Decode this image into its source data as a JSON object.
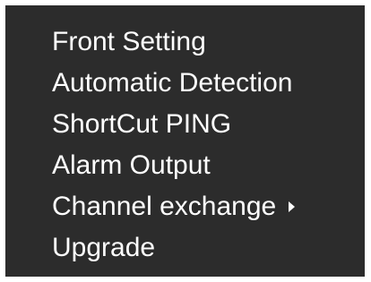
{
  "menu": {
    "items": [
      {
        "label": "Front Setting",
        "has_submenu": false
      },
      {
        "label": "Automatic Detection",
        "has_submenu": false
      },
      {
        "label": "ShortCut PING",
        "has_submenu": false
      },
      {
        "label": "Alarm Output",
        "has_submenu": false
      },
      {
        "label": "Channel exchange",
        "has_submenu": true,
        "submenu_icon": "chevron-right-icon"
      },
      {
        "label": "Upgrade",
        "has_submenu": false
      }
    ]
  },
  "colors": {
    "menu_background": "#2c2c2c",
    "text": "#ffffff",
    "page_background": "#ffffff"
  }
}
